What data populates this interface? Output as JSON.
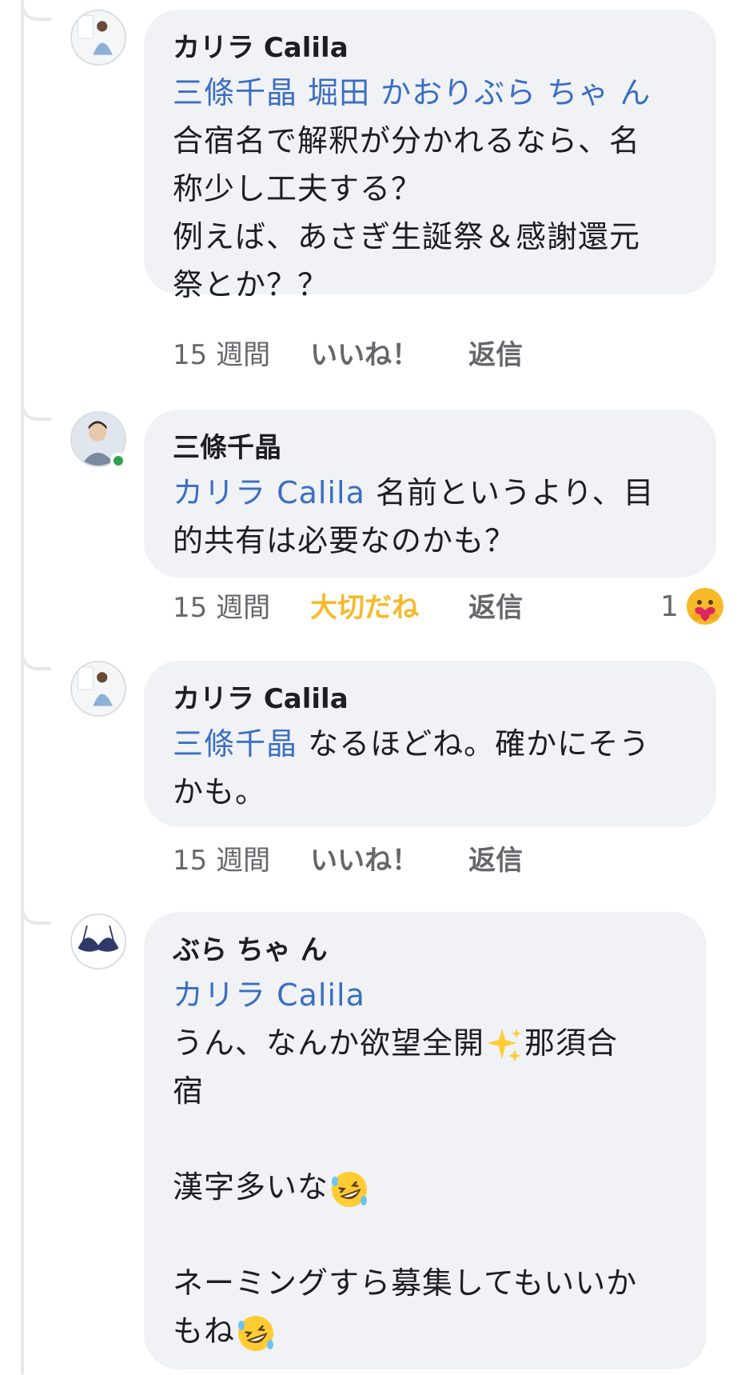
{
  "comments": [
    {
      "author": "カリラ Calila",
      "mentions": "三條千晶 堀田 かおりぶら ちゃ ん",
      "lines": [
        "合宿名で解釈が分かれるなら、名",
        "称少し工夫する？",
        "例えば、あさぎ生誕祭＆感謝還元",
        "祭とか？？"
      ],
      "time": "15 週間",
      "like": "いいね！",
      "reply": "返信"
    },
    {
      "author": "三條千晶",
      "mention": "カリラ Calila",
      "line1_rest": " 名前というより、目",
      "line2": "的共有は必要なのかも？",
      "time": "15 週間",
      "like": "大切だね",
      "reply": "返信",
      "reaction_count": "1"
    },
    {
      "author": "カリラ Calila",
      "mention": "三條千晶",
      "line1_rest": " なるほどね。確かにそう",
      "line2": "かも。",
      "time": "15 週間",
      "like": "いいね！",
      "reply": "返信"
    },
    {
      "author": "ぶら ちゃ ん",
      "mention": "カリラ Calila",
      "line1": "うん、なんか欲望全開",
      "line1_after_emoji": "那須合",
      "line2": "宿",
      "line3": "漢字多いな",
      "line4": "ネーミングすら募集してもいいか",
      "line5": "もね"
    }
  ],
  "colors": {
    "mention": "#3b6ec2",
    "care": "#f7b928",
    "online": "#31a24c",
    "bubble": "#f0f2f5"
  },
  "icons": [
    "sparkles-emoji",
    "rofl-emoji",
    "care-reaction-icon"
  ]
}
